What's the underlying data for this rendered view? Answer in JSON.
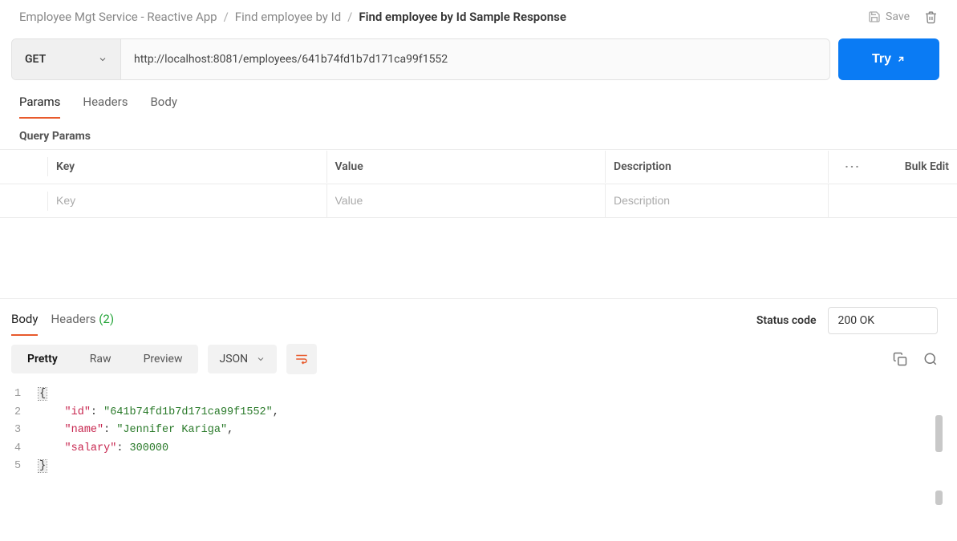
{
  "breadcrumb": {
    "part1": "Employee Mgt Service - Reactive App",
    "part2": "Find employee by Id",
    "current": "Find employee by Id Sample Response"
  },
  "headerActions": {
    "saveLabel": "Save"
  },
  "request": {
    "method": "GET",
    "url": "http://localhost:8081/employees/641b74fd1b7d171ca99f1552",
    "tryLabel": "Try"
  },
  "tabs": {
    "params": "Params",
    "headers": "Headers",
    "body": "Body"
  },
  "queryParams": {
    "title": "Query Params",
    "cols": {
      "key": "Key",
      "value": "Value",
      "description": "Description"
    },
    "placeholders": {
      "key": "Key",
      "value": "Value",
      "description": "Description"
    },
    "bulkEdit": "Bulk Edit"
  },
  "response": {
    "tabs": {
      "body": "Body",
      "headers": "Headers",
      "headerCount": "(2)"
    },
    "statusLabel": "Status code",
    "statusValue": "200 OK",
    "views": {
      "pretty": "Pretty",
      "raw": "Raw",
      "preview": "Preview"
    },
    "format": "JSON",
    "code": {
      "lines": [
        "1",
        "2",
        "3",
        "4",
        "5"
      ],
      "keys": {
        "id": "\"id\"",
        "name": "\"name\"",
        "salary": "\"salary\""
      },
      "vals": {
        "id": "\"641b74fd1b7d171ca99f1552\"",
        "name": "\"Jennifer Kariga\"",
        "salary": "300000"
      }
    }
  }
}
